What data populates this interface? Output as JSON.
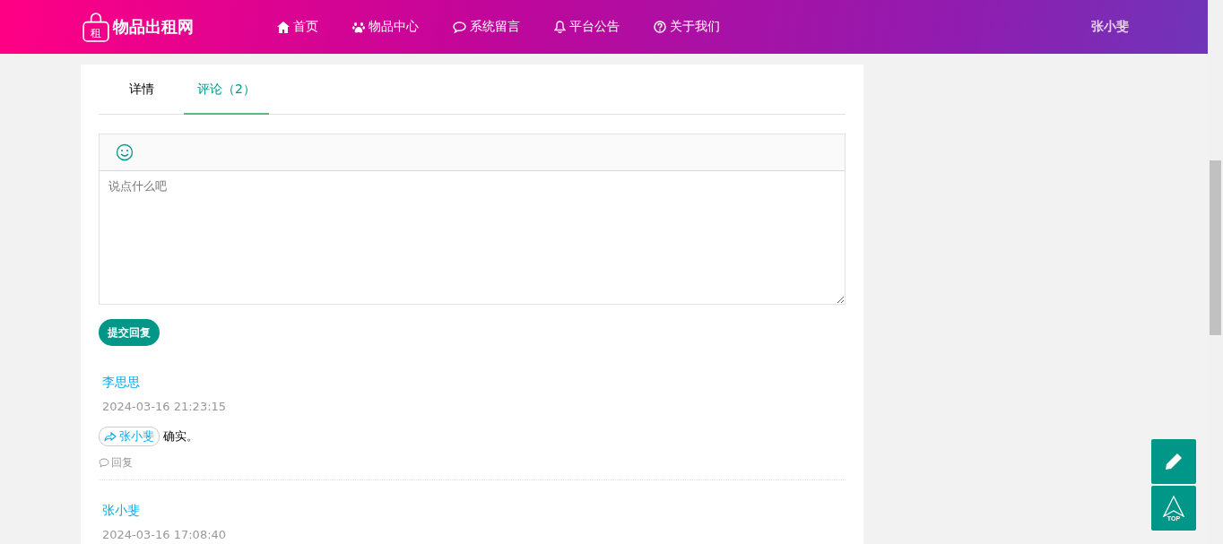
{
  "header": {
    "logo_badge": "租",
    "site_name": "物品出租网",
    "nav": [
      {
        "kind": "home",
        "label": "首页"
      },
      {
        "kind": "paw",
        "label": "物品中心"
      },
      {
        "kind": "chat",
        "label": "系统留言"
      },
      {
        "kind": "bell",
        "label": "平台公告"
      },
      {
        "kind": "question",
        "label": "关于我们"
      }
    ],
    "user": "张小斐"
  },
  "tabs": [
    {
      "label": "详情",
      "selected": false
    },
    {
      "label": "评论（2）",
      "selected": true
    }
  ],
  "editor": {
    "placeholder": "说点什么吧"
  },
  "submit_button": "提交回复",
  "comments": [
    {
      "author": "李思思",
      "time": "2024-03-16 21:23:15",
      "reply_to": "张小斐",
      "text": "确实。",
      "reply_label": "回复"
    },
    {
      "author": "张小斐",
      "time": "2024-03-16 17:08:40"
    }
  ],
  "float_buttons": {
    "top_label": "TOP"
  }
}
